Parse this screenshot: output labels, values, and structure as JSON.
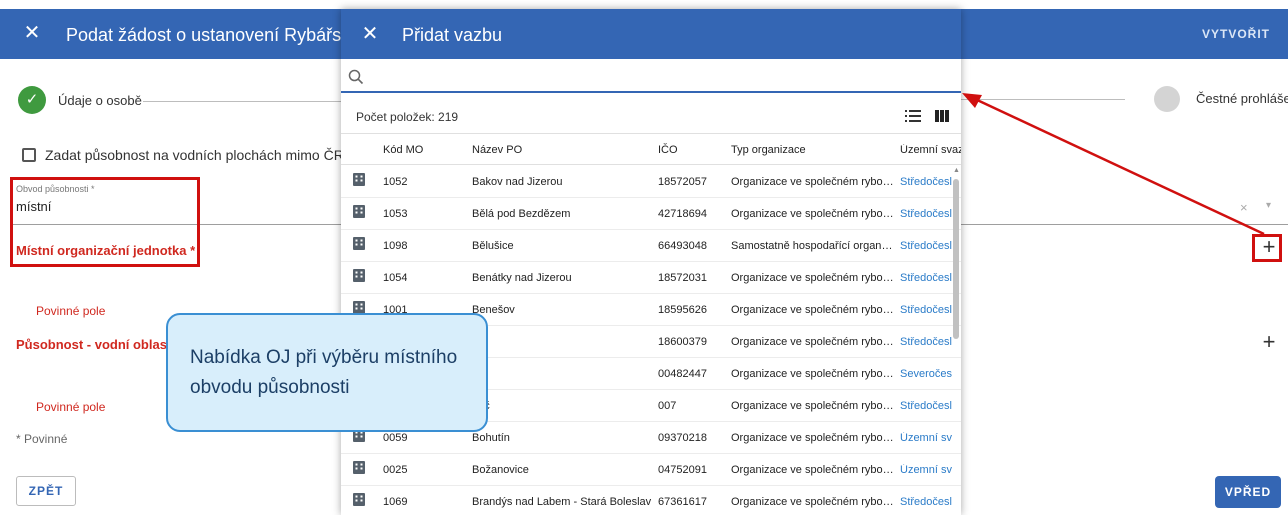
{
  "app": {
    "title": "Podat žádost o ustanovení Rybářské st",
    "create_label": "VYTVOŘIT",
    "close_icon": "close-icon"
  },
  "stepper": {
    "step1_label": "Údaje o osobě",
    "step_last_label": "Čestné prohlášení"
  },
  "form": {
    "checkbox_label": "Zadat působnost na vodních plochách mimo ČRS?",
    "checkbox_checked": false,
    "obvod_label": "Obvod působnosti *",
    "obvod_value": "místní",
    "moj_label": "Místní organizační jednotka *",
    "required_text_1": "Povinné pole",
    "pusobnost_label": "Působnost - vodní oblast",
    "required_text_2": "Povinné pole",
    "required_note": "* Povinné",
    "back_label": "ZPĚT",
    "next_label": "VPŘED",
    "clear_icon": "×",
    "caret_icon": "▾",
    "plus_icon": "+"
  },
  "modal": {
    "title": "Přidat vazbu",
    "search_value": "",
    "count_label": "Počet položek: 219",
    "columns": [
      "Kód MO",
      "Název PO",
      "IČO",
      "Typ organizace",
      "Územní svaz"
    ],
    "rows": [
      {
        "kod": "1052",
        "nazev": "Bakov nad Jizerou",
        "ico": "18572057",
        "typ": "Organizace ve společném rybolo…",
        "uzemni": "Středočesl"
      },
      {
        "kod": "1053",
        "nazev": "Bělá pod Bezdězem",
        "ico": "42718694",
        "typ": "Organizace ve společném rybolo…",
        "uzemni": "Středočesl"
      },
      {
        "kod": "1098",
        "nazev": "Bělušice",
        "ico": "66493048",
        "typ": "Samostatně hospodařící organiz…",
        "uzemni": "Středočesl"
      },
      {
        "kod": "1054",
        "nazev": "Benátky nad Jizerou",
        "ico": "18572031",
        "typ": "Organizace ve společném rybolo…",
        "uzemni": "Středočesl"
      },
      {
        "kod": "1001",
        "nazev": "Benešov",
        "ico": "18595626",
        "typ": "Organizace ve společném rybolo…",
        "uzemni": "Středočesl"
      },
      {
        "kod": "",
        "nazev": "n",
        "ico": "18600379",
        "typ": "Organizace ve společném rybolo…",
        "uzemni": "Středočesl"
      },
      {
        "kod": "",
        "nazev": "",
        "ico": "00482447",
        "typ": "Organizace ve společném rybolo…",
        "uzemni": "Severočes"
      },
      {
        "kod": "",
        "nazev": "neč",
        "ico": "007",
        "typ": "Organizace ve společném rybolo…",
        "uzemni": "Středočesl"
      },
      {
        "kod": "0059",
        "nazev": "Bohutín",
        "ico": "09370218",
        "typ": "Organizace ve společném rybolo…",
        "uzemni": "Územní sv"
      },
      {
        "kod": "0025",
        "nazev": "Božanovice",
        "ico": "04752091",
        "typ": "Organizace ve společném rybolo…",
        "uzemni": "Územní sv"
      },
      {
        "kod": "1069",
        "nazev": "Brandýs nad Labem - Stará Boleslav",
        "ico": "67361617",
        "typ": "Organizace ve společném rybolo…",
        "uzemni": "Středočesl"
      }
    ]
  },
  "callout": {
    "text": "Nabídka OJ při výběru místního obvodu působnosti"
  },
  "colors": {
    "primary": "#3466b4",
    "error": "#d0281f",
    "annotation_red": "#d0100f",
    "callout_bg": "#d8eefb",
    "callout_border": "#3a8fd3",
    "link": "#2a7bc8"
  }
}
